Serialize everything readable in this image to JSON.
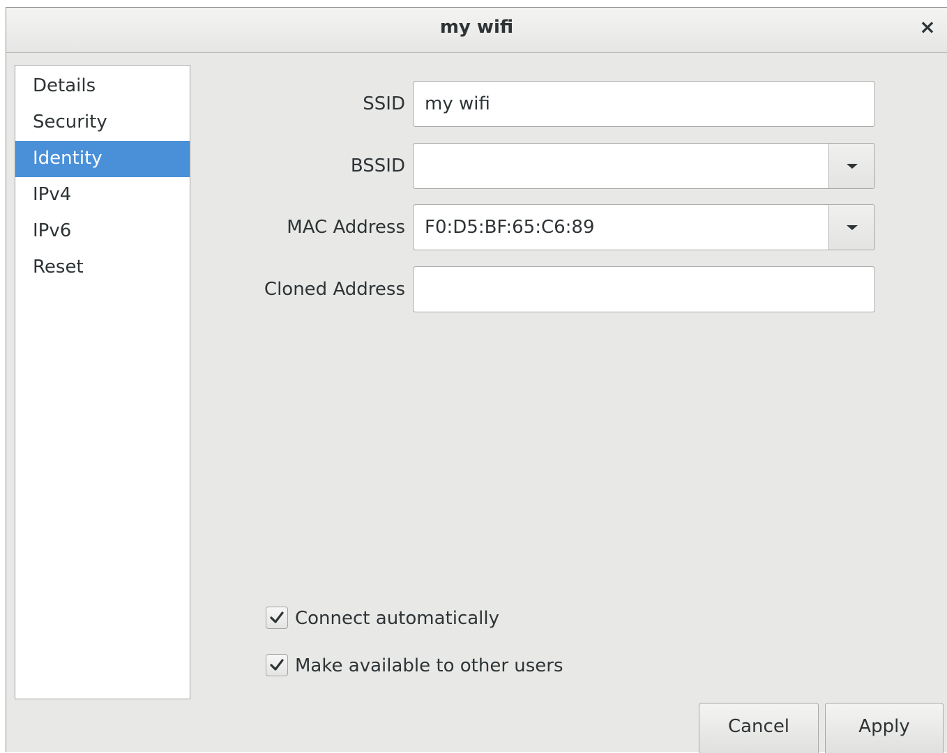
{
  "window": {
    "title": "my wifi",
    "close_glyph": "×"
  },
  "sidebar": {
    "items": [
      {
        "label": "Details",
        "selected": false
      },
      {
        "label": "Security",
        "selected": false
      },
      {
        "label": "Identity",
        "selected": true
      },
      {
        "label": "IPv4",
        "selected": false
      },
      {
        "label": "IPv6",
        "selected": false
      },
      {
        "label": "Reset",
        "selected": false
      }
    ],
    "selected_color": "#4a90d9"
  },
  "form": {
    "ssid": {
      "label": "SSID",
      "value": "my wifi"
    },
    "bssid": {
      "label": "BSSID",
      "value": ""
    },
    "mac": {
      "label": "MAC Address",
      "value": "F0:D5:BF:65:C6:89"
    },
    "cloned": {
      "label": "Cloned Address",
      "value": ""
    }
  },
  "options": {
    "connect_auto": {
      "label": "Connect automatically",
      "checked": true
    },
    "available_others": {
      "label": "Make available to other users",
      "checked": true
    }
  },
  "buttons": {
    "cancel": "Cancel",
    "apply": "Apply"
  },
  "icons": {
    "close": "close-icon",
    "dropdown": "chevron-down-icon",
    "check": "checkmark-icon"
  }
}
